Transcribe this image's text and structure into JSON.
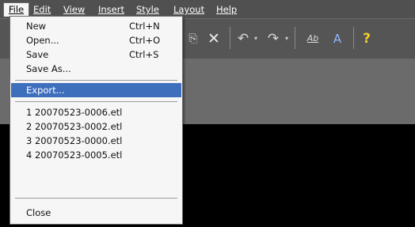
{
  "menubar": {
    "items": [
      {
        "label": "File"
      },
      {
        "label": "Edit"
      },
      {
        "label": "View"
      },
      {
        "label": "Insert"
      },
      {
        "label": "Style"
      },
      {
        "label": "Layout"
      },
      {
        "label": "Help"
      }
    ]
  },
  "toolbar": {
    "icons": [
      "copy-icon",
      "delete-icon",
      "undo-icon",
      "redo-icon",
      "spelling-icon",
      "font-icon",
      "help-icon"
    ],
    "glyphs": {
      "copy": "⎘",
      "delete": "✕",
      "undo": "↶",
      "redo": "↷",
      "spell": "Ab",
      "font": "A",
      "help": "?"
    },
    "caret": "▾"
  },
  "file_menu": {
    "new": {
      "label": "New",
      "shortcut": "Ctrl+N"
    },
    "open": {
      "label": "Open...",
      "shortcut": "Ctrl+O"
    },
    "save": {
      "label": "Save",
      "shortcut": "Ctrl+S"
    },
    "save_as": {
      "label": "Save As..."
    },
    "export": {
      "label": "Export..."
    },
    "recent": [
      {
        "label": "1 20070523-0006.etl"
      },
      {
        "label": "2 20070523-0002.etl"
      },
      {
        "label": "3 20070523-0000.etl"
      },
      {
        "label": "4 20070523-0005.etl"
      }
    ],
    "close": {
      "label": "Close"
    }
  },
  "colors": {
    "menubar_bg": "#505050",
    "menu_highlight": "#3e6fbd",
    "menu_bg": "#f6f6f6"
  }
}
